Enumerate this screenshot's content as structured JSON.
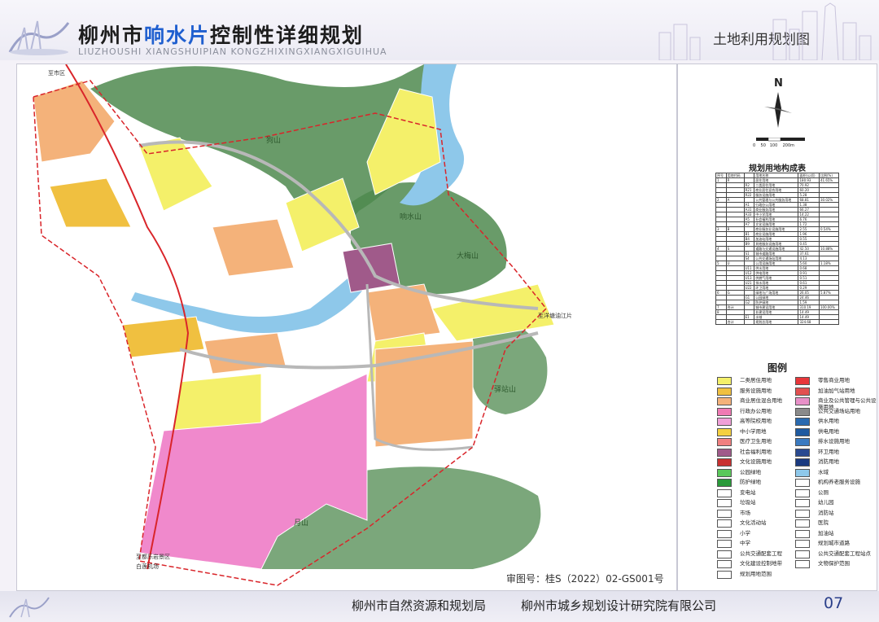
{
  "header": {
    "title_pre": "柳州市",
    "title_highlight": "响水片",
    "title_post": "控制性详细规划",
    "subtitle": "LIUZHOUSHI  XIANGSHUIPIAN  KONGZHIXINGXIANGXIGUIHUA",
    "map_name": "土地利用规划图"
  },
  "compass": {
    "north": "N",
    "scale_ticks": [
      "0",
      "50",
      "100",
      "200m"
    ]
  },
  "table": {
    "title": "规划用地构成表",
    "rows": [
      [
        "序号",
        "用地代码",
        "",
        "用地名称",
        "面积(公顷)",
        "比例(%)"
      ],
      [
        "1",
        "R",
        "",
        "居住用地",
        "180.93",
        "41.65%"
      ],
      [
        "",
        "",
        "R2",
        "二类居住用地",
        "70.92",
        ""
      ],
      [
        "",
        "",
        "R21",
        "商业居住混合用地",
        "60.20",
        ""
      ],
      [
        "",
        "",
        "R22",
        "服务设施用地",
        "5.28",
        ""
      ],
      [
        "2",
        "A",
        "",
        "公共管理与公共服务用地",
        "68.81",
        "30.02%"
      ],
      [
        "",
        "",
        "A1",
        "行政办公用地",
        "1.38",
        ""
      ],
      [
        "",
        "",
        "A31",
        "商业服务用地",
        "66.27",
        ""
      ],
      [
        "",
        "",
        "A33",
        "中小学用地",
        "14.22",
        ""
      ],
      [
        "",
        "",
        "A5",
        "社会福利用地",
        "6.76",
        ""
      ],
      [
        "",
        "",
        "A7",
        "文化设施用地",
        "1.72",
        ""
      ],
      [
        "3",
        "B",
        "",
        "商业服务业设施用地",
        "2.55",
        "0.54%"
      ],
      [
        "",
        "",
        "B1",
        "商业设施用地",
        "1.96",
        ""
      ],
      [
        "",
        "",
        "B4",
        "加油站用地",
        "0.55",
        ""
      ],
      [
        "",
        "",
        "B9",
        "其他服务设施用地",
        "0.45",
        ""
      ],
      [
        "4",
        "S",
        "",
        "道路与交通设施用地",
        "42.50",
        "10.88%"
      ],
      [
        "",
        "",
        "S1",
        "城市道路用地",
        "37.61",
        ""
      ],
      [
        "",
        "",
        "S4",
        "公共交通场站用地",
        "4.13",
        ""
      ],
      [
        "5",
        "U",
        "",
        "公用设施用地",
        "5.60",
        "1.18%"
      ],
      [
        "",
        "",
        "U11",
        "供水用地",
        "0.68",
        ""
      ],
      [
        "",
        "",
        "U12",
        "供电用地",
        "0.91",
        ""
      ],
      [
        "",
        "",
        "U13",
        "供燃气用地",
        "0.51",
        ""
      ],
      [
        "",
        "",
        "U21",
        "排水用地",
        "0.61",
        ""
      ],
      [
        "",
        "",
        "U22",
        "环卫用地",
        "0.29",
        ""
      ],
      [
        "6",
        "G",
        "",
        "绿地与广场用地",
        "26.05",
        "5.87%"
      ],
      [
        "",
        "",
        "G1",
        "公园绿地",
        "24.46",
        ""
      ],
      [
        "",
        "",
        "G2",
        "防护绿地",
        "1.59",
        ""
      ],
      [
        "7",
        "合计",
        "",
        "城市建设用地",
        "310.19",
        "100.00%"
      ],
      [
        "8",
        "",
        "",
        "非建设用地",
        "14.49",
        ""
      ],
      [
        "",
        "",
        "E1",
        "水域",
        "14.49",
        ""
      ],
      [
        "",
        "合计",
        "",
        "规划总用地",
        "324.68",
        ""
      ]
    ]
  },
  "legend": {
    "title": "图例",
    "items": [
      {
        "label": "二类居住用地",
        "color": "#f4f06a"
      },
      {
        "label": "零售商业用地",
        "color": "#e8363a"
      },
      {
        "label": "服务设施用地",
        "color": "#f0c040"
      },
      {
        "label": "加油加气站用地",
        "color": "#e25050"
      },
      {
        "label": "商业居住混合用地",
        "color": "#f4b27a"
      },
      {
        "label": "商业及公共管理与公共设施用地",
        "color": "#e890c8"
      },
      {
        "label": "行政办公用地",
        "color": "#f07ab4"
      },
      {
        "label": "公共交通场站用地",
        "color": "#8a8a8a"
      },
      {
        "label": "高等院校用地",
        "color": "#f0a0d8"
      },
      {
        "label": "供水用地",
        "color": "#2a6ab0"
      },
      {
        "label": "中小学用地",
        "color": "#f5d040"
      },
      {
        "label": "供电用地",
        "color": "#1f5aa0"
      },
      {
        "label": "医疗卫生用地",
        "color": "#f08080"
      },
      {
        "label": "排水设施用地",
        "color": "#3a7ac0"
      },
      {
        "label": "社会福利用地",
        "color": "#a05a8a"
      },
      {
        "label": "环卫用地",
        "color": "#2a4a90"
      },
      {
        "label": "文化设施用地",
        "color": "#c83030"
      },
      {
        "label": "消防用地",
        "color": "#1a3a80"
      },
      {
        "label": "公园绿地",
        "color": "#5ac85a"
      },
      {
        "label": "水域",
        "color": "#8ec8ea"
      },
      {
        "label": "防护绿地",
        "color": "#2a9a3a"
      },
      {
        "label": "机构养老服务设施",
        "color": "#ffffff"
      },
      {
        "label": "变电站",
        "color": "#ffffff"
      },
      {
        "label": "公厕",
        "color": "#ffffff"
      },
      {
        "label": "垃圾站",
        "color": "#ffffff"
      },
      {
        "label": "幼儿园",
        "color": "#ffffff"
      },
      {
        "label": "市场",
        "color": "#ffffff"
      },
      {
        "label": "消防站",
        "color": "#ffffff"
      },
      {
        "label": "文化活动站",
        "color": "#ffffff"
      },
      {
        "label": "医院",
        "color": "#ffffff"
      },
      {
        "label": "小学",
        "color": "#ffffff"
      },
      {
        "label": "加油站",
        "color": "#ffffff"
      },
      {
        "label": "中学",
        "color": "#ffffff"
      },
      {
        "label": "规划城市道路",
        "color": "#ffffff"
      },
      {
        "label": "公共交通配套工程",
        "color": "#ffffff"
      },
      {
        "label": "公共交通配套工程站点",
        "color": "#ffffff"
      },
      {
        "label": "文化建设控制地带",
        "color": "#ffffff"
      },
      {
        "label": "文物保护范围",
        "color": "#ffffff"
      },
      {
        "label": "规划用地范围",
        "color": "#ffffff"
      }
    ]
  },
  "map_labels": {
    "to_city": "至市区",
    "mountain_n": "狗山",
    "mountain_a": "响水山",
    "mountain_b": "大梅山",
    "mountain_c": "驿站山",
    "mountain_moon": "月山",
    "to_east": "至洋塘油江片",
    "to_scenic": "至都乐岩景区",
    "to_airport": "白莲机场"
  },
  "approval": "审图号：桂S（2022）02-GS001号",
  "footer": {
    "org1": "柳州市自然资源和规划局",
    "org2": "柳州市城乡规划设计研究院有限公司",
    "page": "07"
  },
  "colors": {
    "residential": "#f4f06a",
    "mixed": "#f4b27a",
    "university": "#f089cc",
    "park": "#5ac85a",
    "mountain": "#4f8a4f",
    "water": "#8ec8ea",
    "road_red": "#d9252a",
    "title_highlight": "#1f5fcf"
  }
}
